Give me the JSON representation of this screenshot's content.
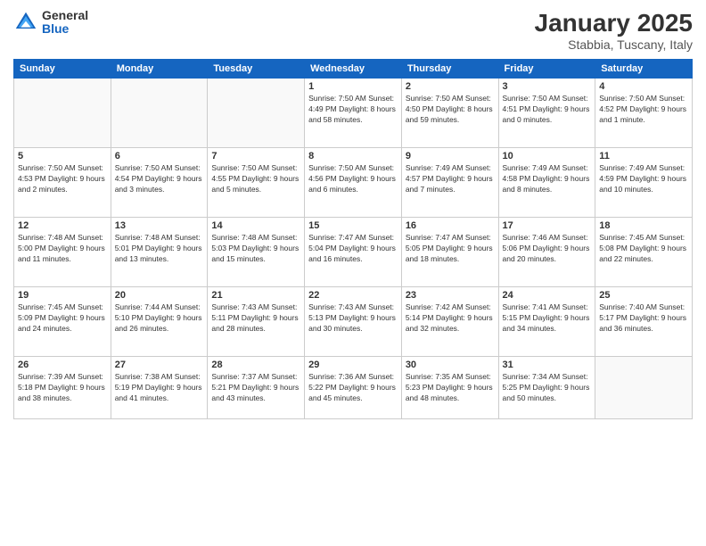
{
  "header": {
    "logo": {
      "general": "General",
      "blue": "Blue"
    },
    "month": "January 2025",
    "location": "Stabbia, Tuscany, Italy"
  },
  "weekdays": [
    "Sunday",
    "Monday",
    "Tuesday",
    "Wednesday",
    "Thursday",
    "Friday",
    "Saturday"
  ],
  "weeks": [
    [
      {
        "day": "",
        "info": ""
      },
      {
        "day": "",
        "info": ""
      },
      {
        "day": "",
        "info": ""
      },
      {
        "day": "1",
        "info": "Sunrise: 7:50 AM\nSunset: 4:49 PM\nDaylight: 8 hours and 58 minutes."
      },
      {
        "day": "2",
        "info": "Sunrise: 7:50 AM\nSunset: 4:50 PM\nDaylight: 8 hours and 59 minutes."
      },
      {
        "day": "3",
        "info": "Sunrise: 7:50 AM\nSunset: 4:51 PM\nDaylight: 9 hours and 0 minutes."
      },
      {
        "day": "4",
        "info": "Sunrise: 7:50 AM\nSunset: 4:52 PM\nDaylight: 9 hours and 1 minute."
      }
    ],
    [
      {
        "day": "5",
        "info": "Sunrise: 7:50 AM\nSunset: 4:53 PM\nDaylight: 9 hours and 2 minutes."
      },
      {
        "day": "6",
        "info": "Sunrise: 7:50 AM\nSunset: 4:54 PM\nDaylight: 9 hours and 3 minutes."
      },
      {
        "day": "7",
        "info": "Sunrise: 7:50 AM\nSunset: 4:55 PM\nDaylight: 9 hours and 5 minutes."
      },
      {
        "day": "8",
        "info": "Sunrise: 7:50 AM\nSunset: 4:56 PM\nDaylight: 9 hours and 6 minutes."
      },
      {
        "day": "9",
        "info": "Sunrise: 7:49 AM\nSunset: 4:57 PM\nDaylight: 9 hours and 7 minutes."
      },
      {
        "day": "10",
        "info": "Sunrise: 7:49 AM\nSunset: 4:58 PM\nDaylight: 9 hours and 8 minutes."
      },
      {
        "day": "11",
        "info": "Sunrise: 7:49 AM\nSunset: 4:59 PM\nDaylight: 9 hours and 10 minutes."
      }
    ],
    [
      {
        "day": "12",
        "info": "Sunrise: 7:48 AM\nSunset: 5:00 PM\nDaylight: 9 hours and 11 minutes."
      },
      {
        "day": "13",
        "info": "Sunrise: 7:48 AM\nSunset: 5:01 PM\nDaylight: 9 hours and 13 minutes."
      },
      {
        "day": "14",
        "info": "Sunrise: 7:48 AM\nSunset: 5:03 PM\nDaylight: 9 hours and 15 minutes."
      },
      {
        "day": "15",
        "info": "Sunrise: 7:47 AM\nSunset: 5:04 PM\nDaylight: 9 hours and 16 minutes."
      },
      {
        "day": "16",
        "info": "Sunrise: 7:47 AM\nSunset: 5:05 PM\nDaylight: 9 hours and 18 minutes."
      },
      {
        "day": "17",
        "info": "Sunrise: 7:46 AM\nSunset: 5:06 PM\nDaylight: 9 hours and 20 minutes."
      },
      {
        "day": "18",
        "info": "Sunrise: 7:45 AM\nSunset: 5:08 PM\nDaylight: 9 hours and 22 minutes."
      }
    ],
    [
      {
        "day": "19",
        "info": "Sunrise: 7:45 AM\nSunset: 5:09 PM\nDaylight: 9 hours and 24 minutes."
      },
      {
        "day": "20",
        "info": "Sunrise: 7:44 AM\nSunset: 5:10 PM\nDaylight: 9 hours and 26 minutes."
      },
      {
        "day": "21",
        "info": "Sunrise: 7:43 AM\nSunset: 5:11 PM\nDaylight: 9 hours and 28 minutes."
      },
      {
        "day": "22",
        "info": "Sunrise: 7:43 AM\nSunset: 5:13 PM\nDaylight: 9 hours and 30 minutes."
      },
      {
        "day": "23",
        "info": "Sunrise: 7:42 AM\nSunset: 5:14 PM\nDaylight: 9 hours and 32 minutes."
      },
      {
        "day": "24",
        "info": "Sunrise: 7:41 AM\nSunset: 5:15 PM\nDaylight: 9 hours and 34 minutes."
      },
      {
        "day": "25",
        "info": "Sunrise: 7:40 AM\nSunset: 5:17 PM\nDaylight: 9 hours and 36 minutes."
      }
    ],
    [
      {
        "day": "26",
        "info": "Sunrise: 7:39 AM\nSunset: 5:18 PM\nDaylight: 9 hours and 38 minutes."
      },
      {
        "day": "27",
        "info": "Sunrise: 7:38 AM\nSunset: 5:19 PM\nDaylight: 9 hours and 41 minutes."
      },
      {
        "day": "28",
        "info": "Sunrise: 7:37 AM\nSunset: 5:21 PM\nDaylight: 9 hours and 43 minutes."
      },
      {
        "day": "29",
        "info": "Sunrise: 7:36 AM\nSunset: 5:22 PM\nDaylight: 9 hours and 45 minutes."
      },
      {
        "day": "30",
        "info": "Sunrise: 7:35 AM\nSunset: 5:23 PM\nDaylight: 9 hours and 48 minutes."
      },
      {
        "day": "31",
        "info": "Sunrise: 7:34 AM\nSunset: 5:25 PM\nDaylight: 9 hours and 50 minutes."
      },
      {
        "day": "",
        "info": ""
      }
    ]
  ]
}
